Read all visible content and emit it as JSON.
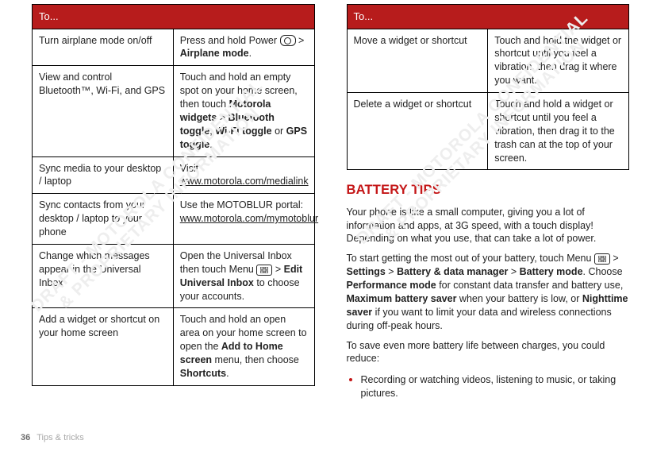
{
  "footer": {
    "page": "36",
    "section": "Tips & tricks"
  },
  "watermark": {
    "line1": "DRAFT - MOTOROLA CONFIDENTIAL",
    "line2": "& PROPRIETARY INFORMATION"
  },
  "tableHeader": "To...",
  "leftRows": [
    {
      "k": "Turn airplane mode on/off",
      "pre": "Press and hold Power ",
      "post": " > ",
      "b": "Airplane mode",
      "suf": "."
    },
    {
      "k": "View and control Bluetooth™, Wi-Fi, and GPS",
      "pre": "Touch and hold an empty spot on your home screen, then touch ",
      "b1": "Motorola widgets",
      "sep1": " > ",
      "b2": "Bluetooth toggle",
      "sep2": ", ",
      "b3": "Wi-Fi toggle",
      "sep3": " or ",
      "b4": "GPS toggle",
      "suf": "."
    },
    {
      "k": "Sync media to your desktop / laptop",
      "pre": "Visit ",
      "link": "www.motorola.com/medialink"
    },
    {
      "k": "Sync contacts from your desktop / laptop to your phone",
      "pre": "Use the MOTOBLUR portal: ",
      "link": "www.motorola.com/mymotoblur"
    },
    {
      "k": "Change which messages appear in the Universal Inbox",
      "pre": "Open the Universal Inbox then touch Menu ",
      "post": " > ",
      "b": "Edit Universal Inbox",
      "suf": " to choose your accounts."
    },
    {
      "k": "Add a widget or shortcut on your home screen",
      "pre": "Touch and hold an open area on your home screen to open the ",
      "b": "Add to Home screen",
      "mid": " menu, then choose ",
      "b2": "Shortcuts",
      "suf": "."
    }
  ],
  "rightRows": [
    {
      "k": "Move a widget or shortcut",
      "v": "Touch and hold the widget or shortcut until you feel a vibration, then drag it where you want."
    },
    {
      "k": "Delete a widget or shortcut",
      "v": "Touch and hold a widget or shortcut until you feel a vibration, then drag it to the trash can at the top of your screen."
    }
  ],
  "heading": "BATTERY TIPS",
  "para1": "Your phone is like a small computer, giving you a lot of information and apps, at 3G speed, with a touch display! Depending on what you use, that can take a lot of power.",
  "startTips": {
    "pre": "To start getting the most out of your battery, touch Menu ",
    "s1": " > ",
    "b1": "Settings",
    "s2": " > ",
    "b2": "Battery & data manager",
    "s3": " > ",
    "b3": "Battery mode",
    "post": ". Choose ",
    "b4": "Performance mode",
    "mid1": " for constant data transfer and battery use, ",
    "b5": "Maximum battery saver",
    "mid2": " when your battery is low, or ",
    "b6": "Nighttime saver",
    "mid3": " if you want to limit your data and wireless connections during off-peak hours."
  },
  "para3": "To save even more battery life between charges, you could reduce:",
  "bullet1": "Recording or watching videos, listening to music, or taking pictures."
}
